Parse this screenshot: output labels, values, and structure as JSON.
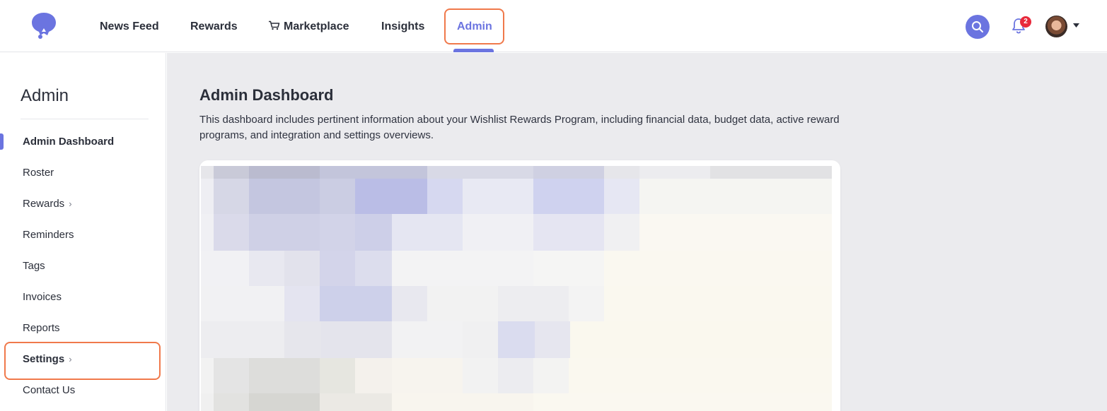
{
  "nav": {
    "items": [
      {
        "label": "News Feed"
      },
      {
        "label": "Rewards"
      },
      {
        "label": "Marketplace",
        "icon": "cart-icon"
      },
      {
        "label": "Insights"
      },
      {
        "label": "Admin",
        "active": true
      }
    ],
    "notifications_count": "2",
    "accent_color": "#6b74e0",
    "highlight_color": "#f0794b",
    "badge_color": "#e8293b"
  },
  "sidebar": {
    "title": "Admin",
    "items": [
      {
        "label": "Admin Dashboard",
        "active": true
      },
      {
        "label": "Roster"
      },
      {
        "label": "Rewards",
        "has_submenu": true
      },
      {
        "label": "Reminders"
      },
      {
        "label": "Tags"
      },
      {
        "label": "Invoices"
      },
      {
        "label": "Reports"
      },
      {
        "label": "Settings",
        "has_submenu": true,
        "highlighted": true
      },
      {
        "label": "Contact Us"
      }
    ]
  },
  "main": {
    "title": "Admin Dashboard",
    "description": "This dashboard includes pertinent information about your Wishlist Rewards Program, including financial data, budget data, active reward programs, and integration and settings overviews.",
    "preview": "blurred dashboard content"
  }
}
